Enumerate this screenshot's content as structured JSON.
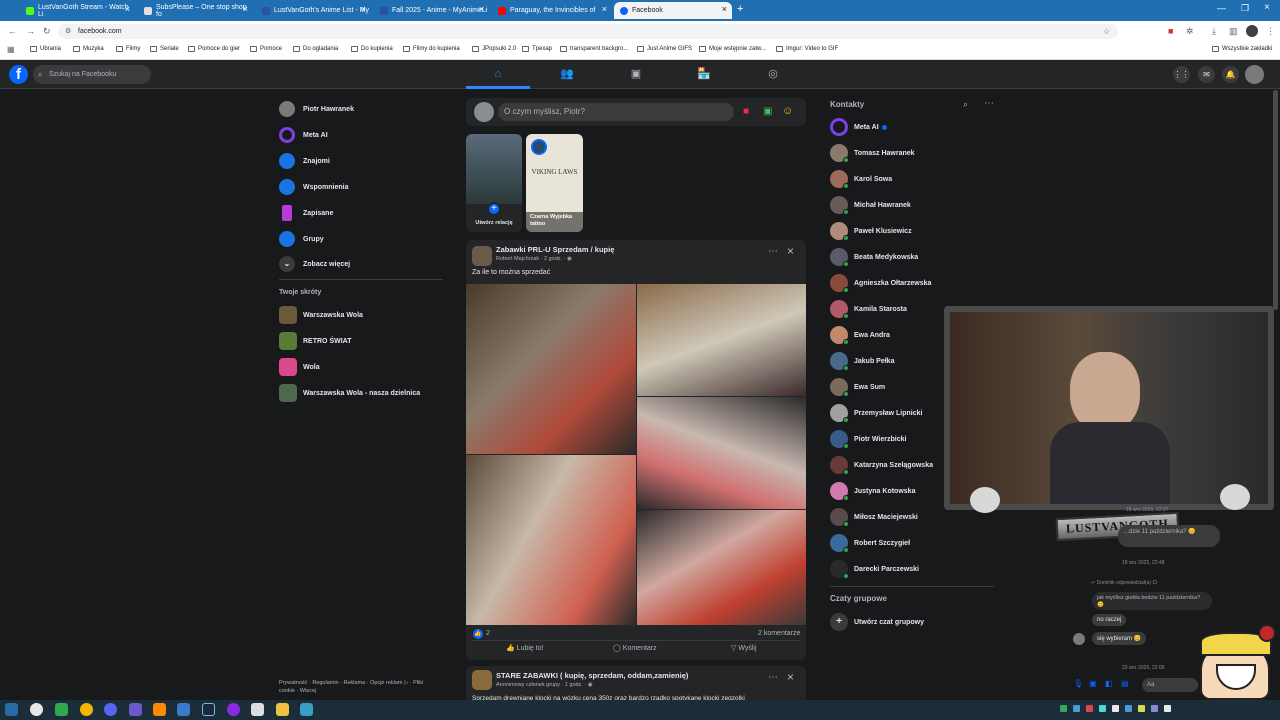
{
  "browser": {
    "tabs": [
      {
        "label": "LustVanGoth Stream - Watch Li",
        "color": "#53fc18"
      },
      {
        "label": "SubsPlease – One stop shop fo",
        "color": "#e0e0e0"
      },
      {
        "label": "LustVanGoth's Anime List - My",
        "color": "#2e51a2"
      },
      {
        "label": "Fall 2025 - Anime - MyAnimeLi",
        "color": "#2e51a2"
      },
      {
        "label": "Paraguay, the Invincibles of",
        "color": "#ff0000"
      },
      {
        "label": "Facebook",
        "color": "#0866ff"
      }
    ],
    "url": "facebook.com",
    "bookmarks": [
      "Ubrania",
      "Muzyka",
      "Filmy",
      "Seriale",
      "Pomoce do gier",
      "Pomoce",
      "Do ogladania",
      "Do kupienia",
      "Filmy do kupienia",
      "JPopsuki 2.0",
      "Tpexap",
      "transparent backgro...",
      "Just Anime GIFS",
      "Moje wstępnie zatw...",
      "Imgur: Video to GIF"
    ],
    "all_bookmarks": "Wszystkie zakładki"
  },
  "fb": {
    "search_placeholder": "Szukaj na Facebooku",
    "left_nav": [
      {
        "label": "Piotr Hawranek",
        "color": "#7a7a7a"
      },
      {
        "label": "Meta AI",
        "color": "#7b3fe4"
      },
      {
        "label": "Znajomi",
        "color": "#1b74e4"
      },
      {
        "label": "Wspomnienia",
        "color": "#1b74e4"
      },
      {
        "label": "Zapisane",
        "color": "#b83bd9"
      },
      {
        "label": "Grupy",
        "color": "#1b74e4"
      },
      {
        "label": "Zobacz więcej",
        "color": "#3a3b3c"
      }
    ],
    "shortcuts_title": "Twoje skróty",
    "shortcuts": [
      {
        "label": "Warszawska Wola",
        "color": "#6b5a3a"
      },
      {
        "label": "RETRO ŚWIAT",
        "color": "#5a7a3a"
      },
      {
        "label": "Wola",
        "color": "#d94a8a"
      },
      {
        "label": "Warszawska Wola - nasza dzielnica",
        "color": "#4a6a4a"
      }
    ],
    "footer": [
      "Prywatność",
      "Regulamin",
      "Reklama",
      "Opcje reklam",
      "Pliki cookie",
      "Więcej"
    ],
    "composer_placeholder": "O czym myślisz, Piotr?",
    "stories": [
      {
        "label": "Utwórz relację"
      },
      {
        "label": "Czarna Wyjebka tattoo",
        "inner": "VIKING LAWS"
      }
    ],
    "post1": {
      "group": "Zabawki PRL-U Sprzedam / kupię",
      "author": "Robert Majchrzak",
      "time": "2 godz.",
      "text": "Za ile to można sprzedać",
      "reactions": "2",
      "comments": "2 komentarze",
      "like": "Lubię to!",
      "comment": "Komentarz",
      "share": "Wyślij"
    },
    "post2": {
      "group": "STARE ZABAWKI ( kupię, sprzedam, oddam,zamienię)",
      "author": "Anonimowy członek grupy",
      "time": "1 godz.",
      "text": "Sprzedam drewniane klocki na wózku cena 350z oraz bardzo rzadko spotykane klocki zegzolki"
    },
    "contacts_title": "Kontakty",
    "contacts": [
      {
        "name": "Meta AI",
        "color": "#7b3fe4",
        "online": false
      },
      {
        "name": "Tomasz Hawranek",
        "color": "#8a7a6a",
        "online": true
      },
      {
        "name": "Karol Sowa",
        "color": "#9a6a5a",
        "online": true
      },
      {
        "name": "Michał Hawranek",
        "color": "#6a5a5a",
        "online": true
      },
      {
        "name": "Paweł Klusiewicz",
        "color": "#b08a7a",
        "online": true
      },
      {
        "name": "Beata Medykowska",
        "color": "#5a5a6a",
        "online": true
      },
      {
        "name": "Agnieszka Ołtarzewska",
        "color": "#8a4a3a",
        "online": true
      },
      {
        "name": "Kamila Starosta",
        "color": "#b05a6a",
        "online": true
      },
      {
        "name": "Ewa Andra",
        "color": "#c08a6a",
        "online": true
      },
      {
        "name": "Jakub Pełka",
        "color": "#4a6a8a",
        "online": true
      },
      {
        "name": "Ewa Sum",
        "color": "#7a6a5a",
        "online": true
      },
      {
        "name": "Przemysław Lipnicki",
        "color": "#a0a0a0",
        "online": true
      },
      {
        "name": "Piotr Wierzbicki",
        "color": "#3a5a8a",
        "online": true
      },
      {
        "name": "Katarzyna Szelągowska",
        "color": "#6a3a3a",
        "online": true
      },
      {
        "name": "Justyna Kotowska",
        "color": "#d07ab0",
        "online": true
      },
      {
        "name": "Miłosz Maciejewski",
        "color": "#5a4a4a",
        "online": true
      },
      {
        "name": "Robert Szczygieł",
        "color": "#3a6a9a",
        "online": true
      },
      {
        "name": "Darecki Parczewski",
        "color": "#2a2a2a",
        "online": true
      }
    ],
    "group_chats_title": "Czaty grupowe",
    "create_group_chat": "Utwórz czat grupowy"
  },
  "overlay": {
    "logo_text": "LUSTVANGOTH",
    "chat": {
      "ts1": "18 wrz 2025, 22:27",
      "bubble1": "...dzie 11 października? 😊",
      "ts2": "18 wrz 2025, 22:48",
      "reply_note": "Dominik odpowiedział(a) Ci",
      "quoted": "jak myślisz giełda bedzie 11 października? 😊",
      "msg1": "no raczej",
      "msg2": "się wybieram 😊",
      "ts3": "23 wrz 2025, 22:05",
      "input_placeholder": "Aa"
    }
  }
}
